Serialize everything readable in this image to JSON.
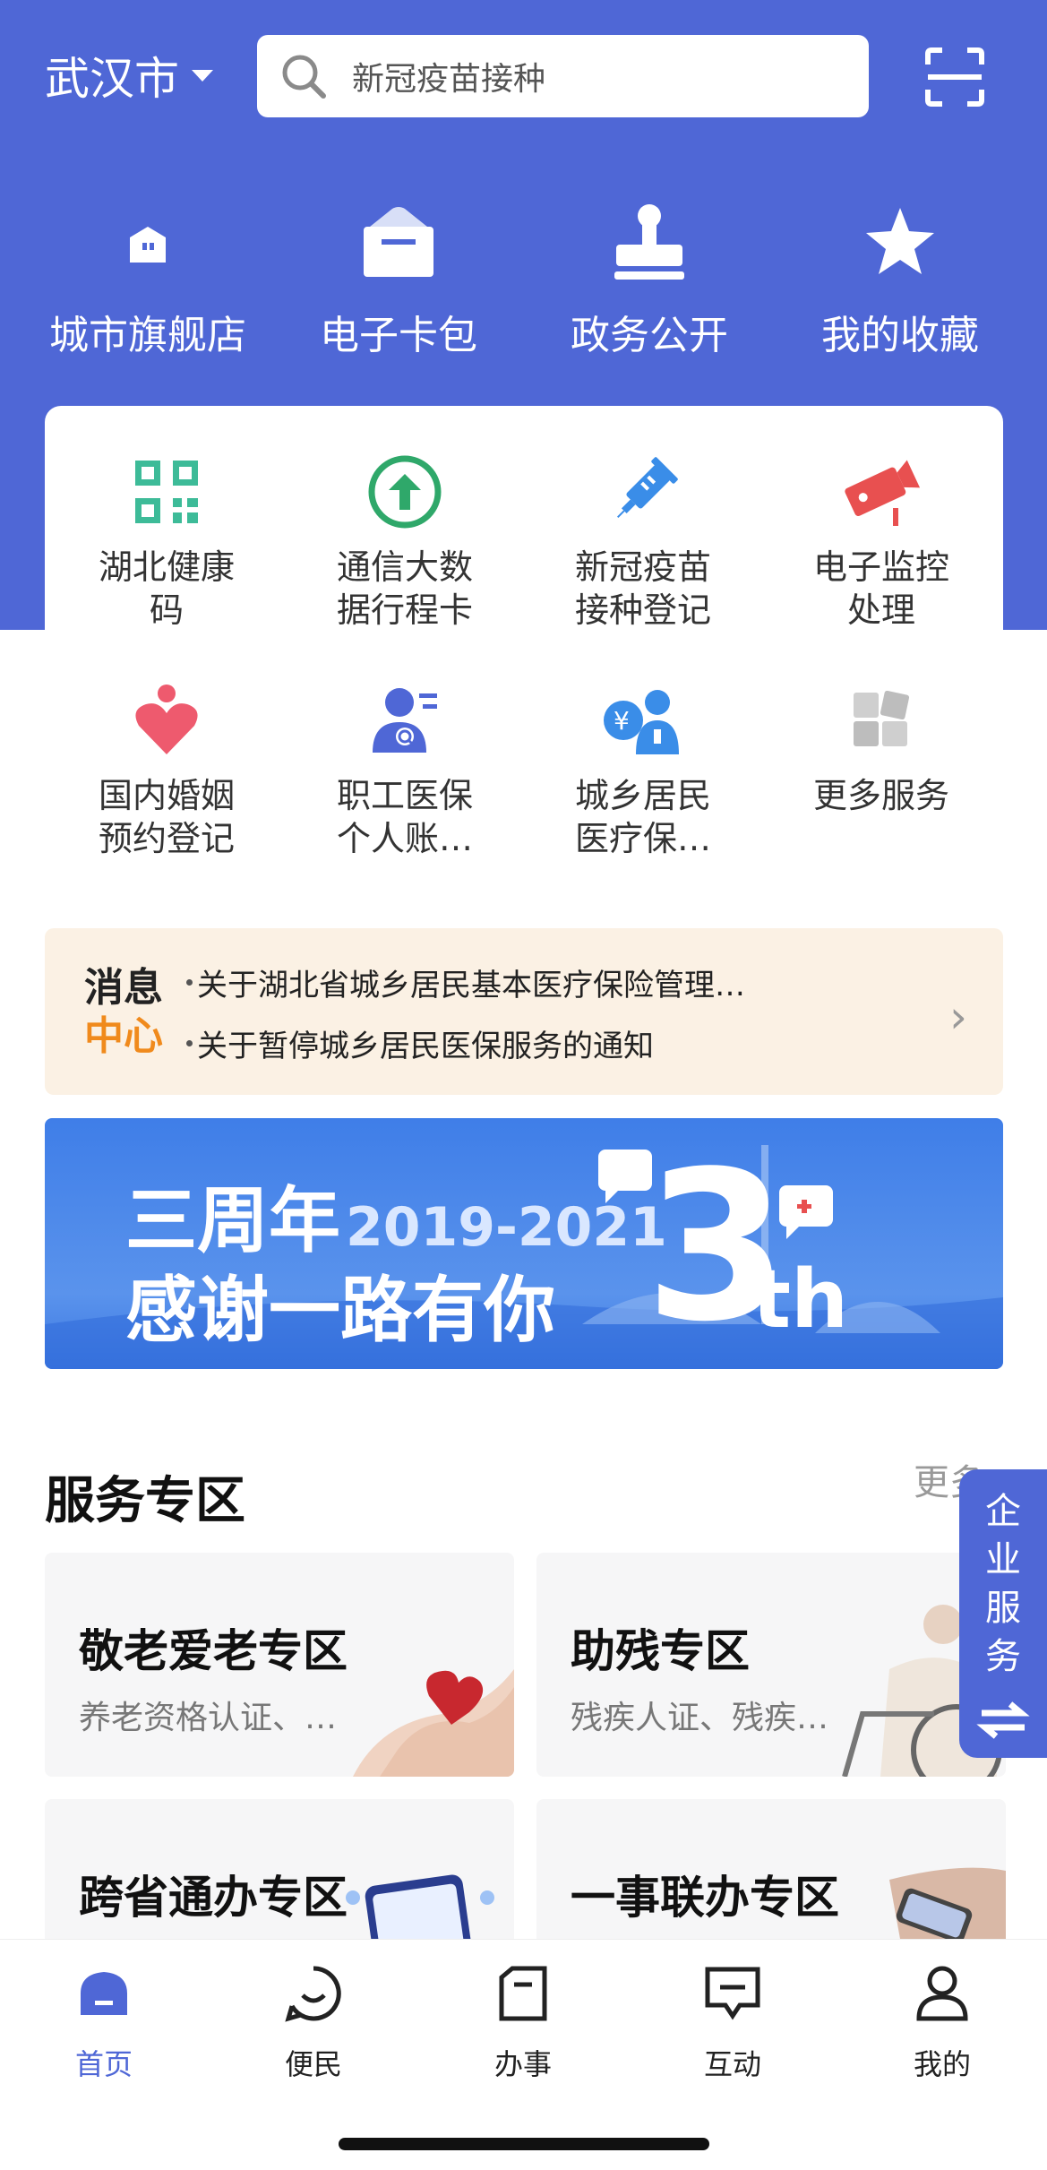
{
  "header": {
    "city": "武汉市",
    "search_placeholder": "新冠疫苗接种"
  },
  "quick_actions": [
    {
      "label": "城市旗舰店",
      "icon": "store-icon"
    },
    {
      "label": "电子卡包",
      "icon": "wallet-icon"
    },
    {
      "label": "政务公开",
      "icon": "stamp-icon"
    },
    {
      "label": "我的收藏",
      "icon": "star-icon"
    }
  ],
  "services": [
    {
      "label": "湖北健康\n码",
      "icon": "qr-code-icon",
      "color": "#3dbb98"
    },
    {
      "label": "通信大数\n据行程卡",
      "icon": "arrow-up-circle-icon",
      "color": "#2fa86a"
    },
    {
      "label": "新冠疫苗\n接种登记",
      "icon": "syringe-icon",
      "color": "#3a8de8"
    },
    {
      "label": "电子监控\n处理",
      "icon": "camera-icon",
      "color": "#e85050"
    },
    {
      "label": "国内婚姻\n预约登记",
      "icon": "heart-icon",
      "color": "#ee5a6e"
    },
    {
      "label": "职工医保\n个人账…",
      "icon": "person-search-icon",
      "color": "#4f67d6"
    },
    {
      "label": "城乡居民\n医疗保…",
      "icon": "doctor-icon",
      "color": "#3a8de8"
    },
    {
      "label": "更多服务",
      "icon": "grid-icon",
      "color": "#c7c7c7"
    }
  ],
  "notice": {
    "logo_line1": "消息",
    "logo_line2": "中心",
    "items": [
      "关于湖北省城乡居民基本医疗保险管理…",
      "关于暂停城乡居民医保服务的通知"
    ]
  },
  "banner": {
    "line1": "三周年",
    "years": "2019-2021",
    "line2": "感谢一路有你",
    "badge": "3",
    "badge_suffix": "th"
  },
  "service_zone": {
    "title": "服务专区",
    "more": "更多",
    "zones": [
      {
        "title": "敬老爱老专区",
        "subtitle": "养老资格认证、…"
      },
      {
        "title": "助残专区",
        "subtitle": "残疾人证、残疾…"
      },
      {
        "title": "跨省通办专区",
        "subtitle": ""
      },
      {
        "title": "一事联办专区",
        "subtitle": ""
      }
    ]
  },
  "enterprise_tab": "企业服务",
  "tabbar": [
    {
      "label": "首页",
      "icon": "home-icon",
      "active": true
    },
    {
      "label": "便民",
      "icon": "smile-icon",
      "active": false
    },
    {
      "label": "办事",
      "icon": "document-icon",
      "active": false
    },
    {
      "label": "互动",
      "icon": "chat-icon",
      "active": false
    },
    {
      "label": "我的",
      "icon": "user-icon",
      "active": false
    }
  ],
  "colors": {
    "primary": "#4f67d6",
    "notice_bg": "#fbf1e4",
    "notice_accent": "#f08a1c"
  }
}
